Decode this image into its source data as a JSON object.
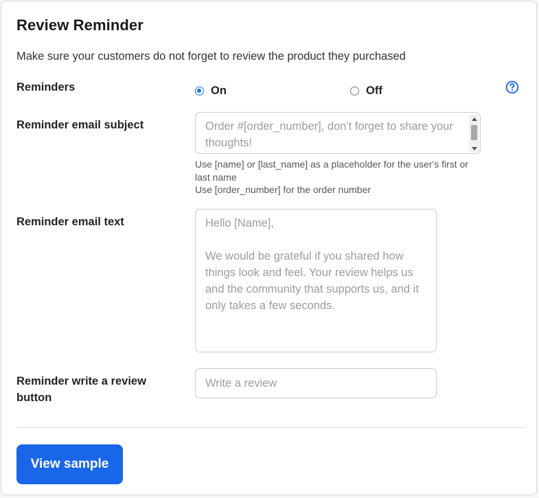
{
  "section": {
    "title": "Review Reminder",
    "description": "Make sure your customers do not forget to review the product they purchased"
  },
  "reminders": {
    "label": "Reminders",
    "options": [
      {
        "label": "On",
        "checked": true
      },
      {
        "label": "Off",
        "checked": false
      }
    ],
    "help_icon": "question-circle-icon"
  },
  "subject": {
    "label": "Reminder email subject",
    "placeholder": "Order #[order_number], don't forget to share your thoughts!",
    "hint_line1": "Use [name] or [last_name] as a placeholder for the user's first or last name",
    "hint_line2": "Use [order_number] for the order number"
  },
  "email_text": {
    "label": "Reminder email text",
    "placeholder_line1": "Hello [Name],",
    "placeholder_line2": "We would be grateful if you shared how things look and feel. Your review helps us and the community that supports us, and it only takes a few seconds."
  },
  "review_button": {
    "label": "Reminder write a review button",
    "placeholder": "Write a review"
  },
  "actions": {
    "view_sample_label": "View sample"
  },
  "colors": {
    "accent": "#1a66e8",
    "radio": "#1a73e8"
  }
}
